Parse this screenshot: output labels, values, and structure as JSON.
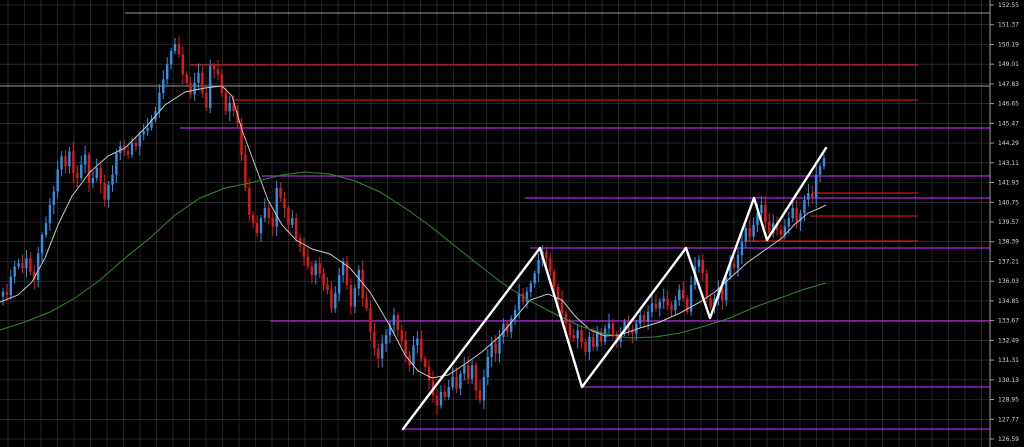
{
  "chart_data": {
    "type": "candlestick",
    "title": "",
    "xlabel": "",
    "ylabel": "",
    "ylim": [
      126.4,
      152.75
    ],
    "grid": true,
    "y_ticks": [
      "152.55",
      "151.37",
      "150.19",
      "149.01",
      "147.83",
      "146.65",
      "145.47",
      "144.29",
      "143.11",
      "141.93",
      "140.75",
      "139.57",
      "138.39",
      "137.21",
      "136.03",
      "134.85",
      "133.67",
      "132.49",
      "131.31",
      "130.13",
      "128.95",
      "127.77",
      "126.59"
    ],
    "colors": {
      "background": "#000000",
      "grid": "#3c3c3c",
      "up": "#2f8fe6",
      "down": "#e01818",
      "sma_fast": "#c8c8c8",
      "sma_slow": "#2f8a2a",
      "zigzag": "#ffffff",
      "support": "#b422e6",
      "resistance": "#c81414"
    },
    "candles_close": [
      135.4,
      135.2,
      136.3,
      136.9,
      137.1,
      136.8,
      137.4,
      136.6,
      136.1,
      137.7,
      138.8,
      139.5,
      140.6,
      141.4,
      142.7,
      143.5,
      142.9,
      143.8,
      142.5,
      142.2,
      143.0,
      143.6,
      141.9,
      142.2,
      142.8,
      141.9,
      140.9,
      141.8,
      142.4,
      143.7,
      144.1,
      143.8,
      143.6,
      144.3,
      144.1,
      144.8,
      145.0,
      145.2,
      145.7,
      146.2,
      147.3,
      148.1,
      149.0,
      149.8,
      150.2,
      149.6,
      148.4,
      147.9,
      147.2,
      147.9,
      148.5,
      147.3,
      146.4,
      148.9,
      148.7,
      148.4,
      147.3,
      146.2,
      146.7,
      146.2,
      145.5,
      143.6,
      141.6,
      140.0,
      139.5,
      138.9,
      139.8,
      140.4,
      139.8,
      139.3,
      141.6,
      141.0,
      140.4,
      139.4,
      139.8,
      138.6,
      138.1,
      137.5,
      136.9,
      136.4,
      137.1,
      136.5,
      135.8,
      135.5,
      134.4,
      135.3,
      136.4,
      137.2,
      135.8,
      134.5,
      135.6,
      136.7,
      135.0,
      134.4,
      133.0,
      132.0,
      131.4,
      132.3,
      132.8,
      133.4,
      134.0,
      133.1,
      132.5,
      131.6,
      131.0,
      132.2,
      132.6,
      131.4,
      130.9,
      130.1,
      129.2,
      128.6,
      129.4,
      129.1,
      129.7,
      130.3,
      129.6,
      130.5,
      131.0,
      130.2,
      131.0,
      129.5,
      128.9,
      130.3,
      131.5,
      132.3,
      131.7,
      132.7,
      133.5,
      133.0,
      133.8,
      134.3,
      135.3,
      134.8,
      135.4,
      135.9,
      136.5,
      137.3,
      137.8,
      137.4,
      136.6,
      135.7,
      134.9,
      134.1,
      133.5,
      132.8,
      132.6,
      133.1,
      132.4,
      131.8,
      132.7,
      132.1,
      133.0,
      132.4,
      133.2,
      133.5,
      132.8,
      132.4,
      132.9,
      133.6,
      133.1,
      132.9,
      133.5,
      134.0,
      133.6,
      134.2,
      134.7,
      134.4,
      134.8,
      135.0,
      134.6,
      134.3,
      134.9,
      135.5,
      135.0,
      134.2,
      135.8,
      136.9,
      137.3,
      136.5,
      135.0,
      134.5,
      135.0,
      135.6,
      134.9,
      136.3,
      137.1,
      136.8,
      137.6,
      138.4,
      139.2,
      138.7,
      139.4,
      140.1,
      140.6,
      139.6,
      138.9,
      139.5,
      139.1,
      138.8,
      139.3,
      139.8,
      140.4,
      139.6,
      140.1,
      140.9,
      141.3,
      141.0,
      142.4,
      142.9,
      143.4
    ]
  }
}
